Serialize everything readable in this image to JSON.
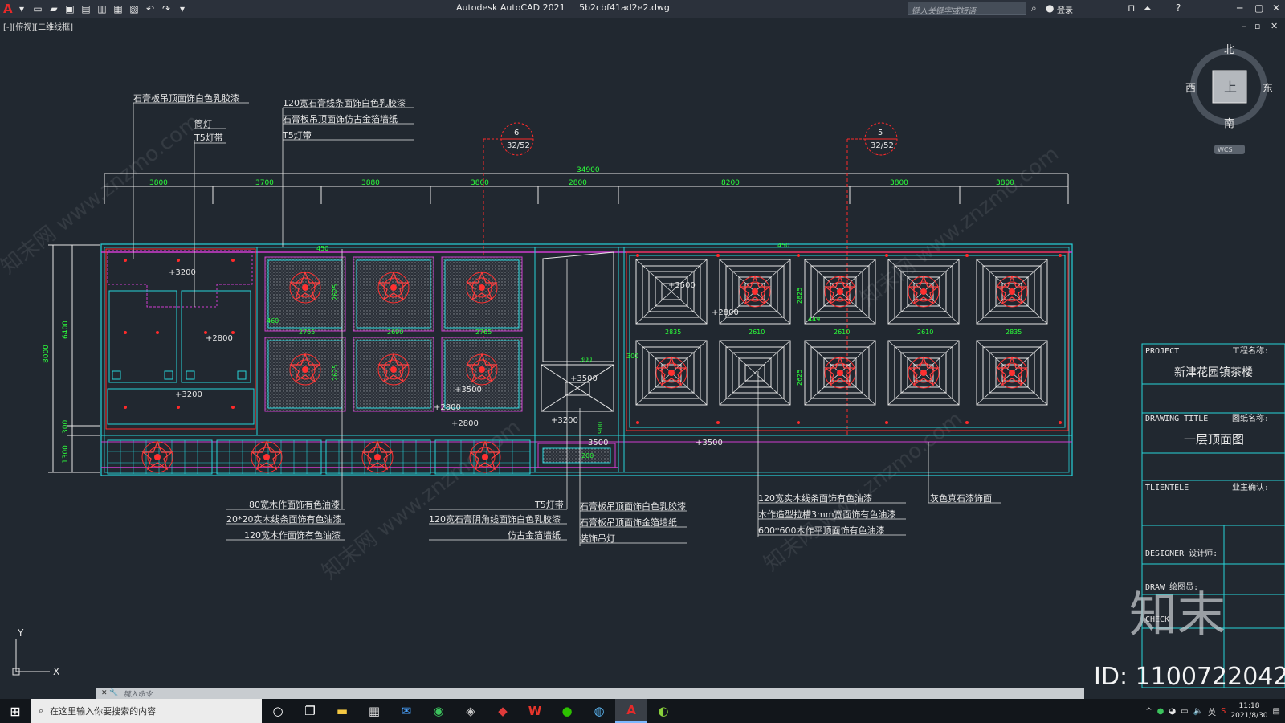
{
  "app": {
    "title": "Autodesk AutoCAD 2021",
    "file": "5b2cbf41ad2e2.dwg",
    "search_placeholder": "键入关键字或短语",
    "login": "登录",
    "view_label": "[-][俯视][二维线框]",
    "command_placeholder": "键入命令"
  },
  "viewcube": {
    "north": "北",
    "south": "南",
    "east": "东",
    "west": "西",
    "face": "上",
    "wcs": "WCS"
  },
  "ucs": {
    "x": "X",
    "y": "Y"
  },
  "drawing": {
    "overall_dim": "34900",
    "top_dims": [
      "3800",
      "3700",
      "3880",
      "3800",
      "2800",
      "8200",
      "3800",
      "3800"
    ],
    "left_dims": [
      "8000",
      "6400",
      "300",
      "1300"
    ],
    "section_marks": [
      {
        "num": "6",
        "sheet": "32/52"
      },
      {
        "num": "5",
        "sheet": "32/52"
      }
    ],
    "elevations": [
      "+3200",
      "+2800",
      "+3200",
      "+3500",
      "+2800",
      "+2800",
      "+3500",
      "+3200",
      "3500",
      "+3500",
      "+2800",
      "+3500"
    ],
    "inner_dims": [
      "2625",
      "2765",
      "2690",
      "2765",
      "2625",
      "460",
      "450",
      "2835",
      "2610",
      "2610",
      "2610",
      "2835",
      "2825",
      "2625",
      "300",
      "300",
      "900",
      "200",
      "449",
      "450"
    ],
    "labels_top": [
      "石膏板吊顶面饰白色乳胶漆",
      "筒灯",
      "T5灯带",
      "120宽石膏线条面饰白色乳胶漆",
      "石膏板吊顶面饰仿古金箔墙纸",
      "T5灯带"
    ],
    "labels_bottom_1": [
      "80宽木作面饰有色油漆",
      "20*20实木线条面饰有色油漆",
      "120宽木作面饰有色油漆"
    ],
    "labels_bottom_2": [
      "T5灯带",
      "120宽石膏阴角线面饰白色乳胶漆",
      "仿古金箔墙纸"
    ],
    "labels_bottom_3": [
      "石膏板吊顶面饰白色乳胶漆",
      "石膏板吊顶面饰金箔墙纸",
      "装饰吊灯"
    ],
    "labels_bottom_4": [
      "120宽实木线条面饰有色油漆",
      "木作造型拉槽3mm宽面饰有色油漆",
      "600*600木作平顶面饰有色油漆"
    ],
    "labels_bottom_5": [
      "灰色真石漆饰面"
    ]
  },
  "title_block": {
    "project_en": "PROJECT",
    "project_cn": "工程名称:",
    "project_name": "新津花园镇茶楼",
    "drawing_title_en": "DRAWING TITLE",
    "drawing_title_cn": "图纸名称:",
    "drawing_name": "一层顶面图",
    "client_en": "TLIENTELE",
    "client_cn": "业主确认:",
    "designer": "DESIGNER  设计师:",
    "draw": "DRAW     绘图员:",
    "check": "CHECK"
  },
  "watermark": {
    "text": "知末网 www.znzmo.com",
    "logo": "知末",
    "id": "ID: 1100722042"
  },
  "taskbar": {
    "search": "在这里输入你要搜索的内容",
    "time": "11:18",
    "date": "2021/8/30",
    "ime": "英"
  },
  "colors": {
    "bg": "#212830",
    "cyan": "#27d3d9",
    "green": "#2bff3a",
    "magenta": "#d03cd0",
    "red": "#ff2a2a",
    "label": "#e6e6e6"
  }
}
